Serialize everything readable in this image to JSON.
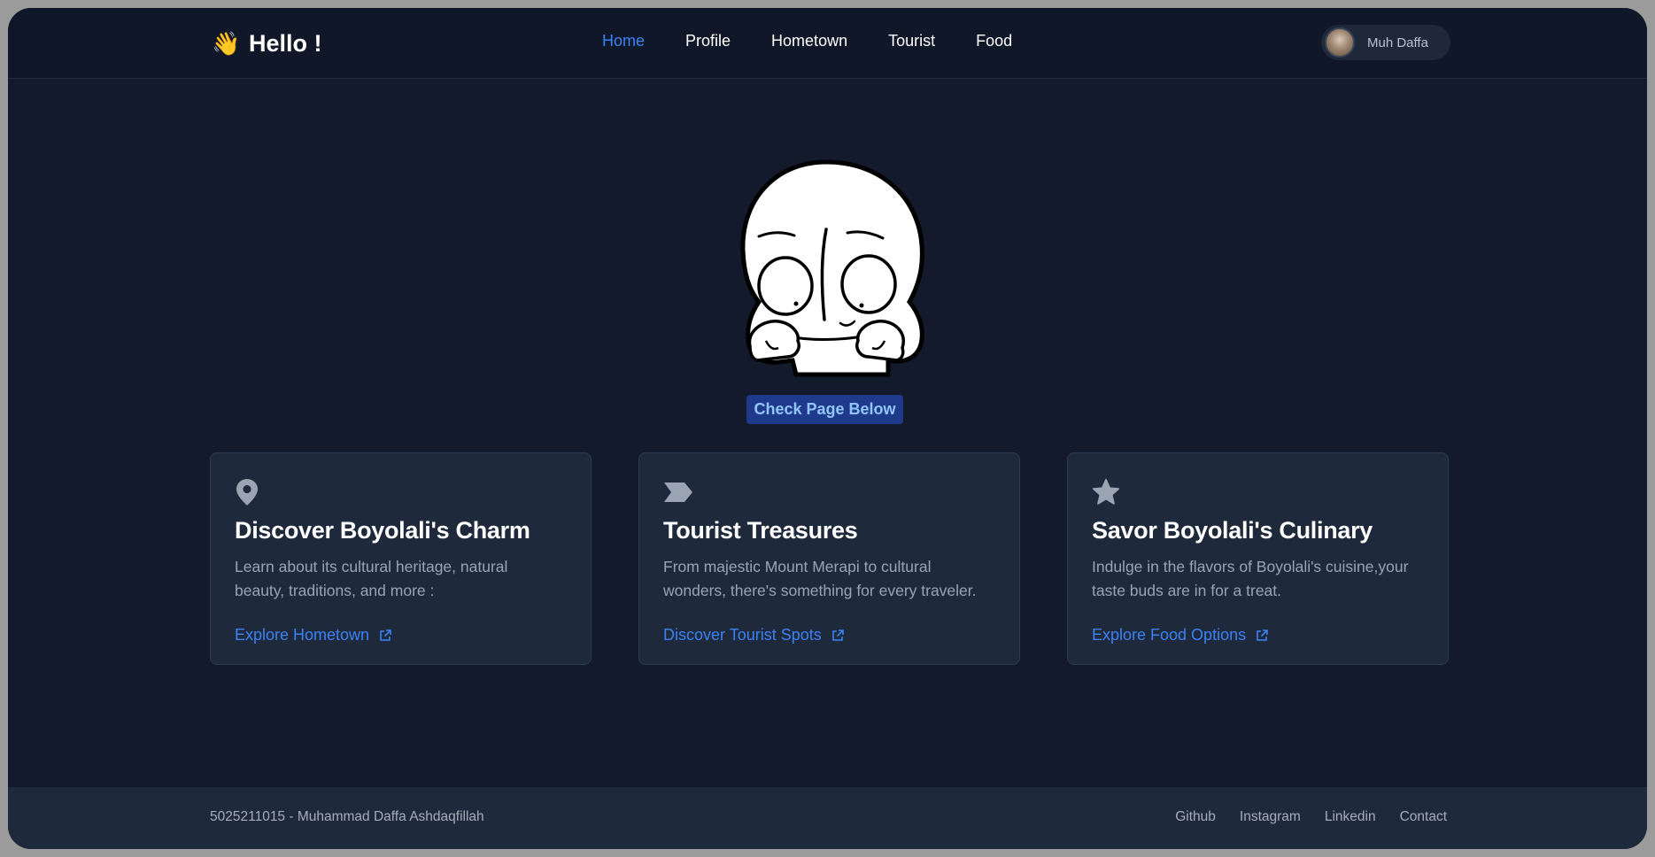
{
  "header": {
    "brand_emoji": "👋",
    "brand_title": "Hello !",
    "nav": [
      "Home",
      "Profile",
      "Hometown",
      "Tourist",
      "Food"
    ],
    "active_nav": "Home",
    "user_name": "Muh Daffa"
  },
  "hero": {
    "button_label": "Check Page Below"
  },
  "cards": [
    {
      "icon": "map-pin-icon",
      "title": "Discover Boyolali's Charm",
      "desc_line1": "Learn about its cultural heritage, natural",
      "desc_line2": "beauty, traditions, and more :",
      "link": "Explore Hometown"
    },
    {
      "icon": "tag-arrow-icon",
      "title": "Tourist Treasures",
      "desc_line1": "From majestic Mount Merapi to cultural",
      "desc_line2": "wonders, there's something for every traveler.",
      "link": "Discover Tourist Spots"
    },
    {
      "icon": "star-icon",
      "title": "Savor Boyolali's Culinary",
      "desc_line1": "Indulge in the flavors of Boyolali's cuisine,your",
      "desc_line2": "taste buds are in for a treat.",
      "link": "Explore Food Options"
    }
  ],
  "footer": {
    "credit": "5025211015 - Muhammad Daffa Ashdaqfillah",
    "links": [
      "Github",
      "Instagram",
      "Linkedin",
      "Contact"
    ]
  },
  "colors": {
    "background": "#121a2b",
    "navbar": "#0f1728",
    "card": "#1e293b",
    "accent": "#3b82f6",
    "button_bg": "#1f3a8a",
    "button_text": "#93c5fd"
  }
}
